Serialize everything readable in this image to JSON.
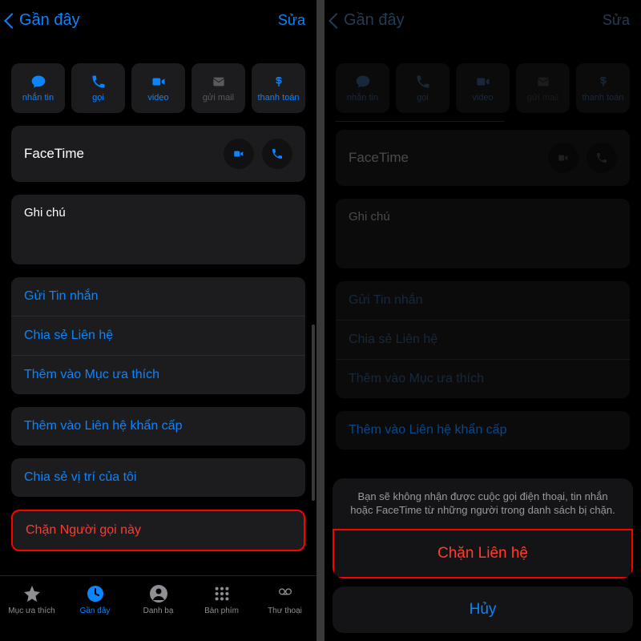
{
  "nav": {
    "back": "Gần đây",
    "edit": "Sửa"
  },
  "quick": {
    "message": "nhắn tin",
    "call": "gọi",
    "video": "video",
    "mail": "gửi mail",
    "pay": "thanh toán"
  },
  "facetime": "FaceTime",
  "notes": "Ghi chú",
  "actions": {
    "send_message": "Gửi Tin nhắn",
    "share_contact": "Chia sẻ Liên hệ",
    "add_favorite": "Thêm vào Mục ưa thích",
    "add_emergency": "Thêm vào Liên hệ khẩn cấp",
    "share_location": "Chia sẻ vị trí của tôi",
    "block": "Chặn Người gọi này"
  },
  "tabs": {
    "favorites": "Mục ưa thích",
    "recents": "Gần đây",
    "contacts": "Danh bạ",
    "keypad": "Bàn phím",
    "voicemail": "Thư thoại"
  },
  "sheet": {
    "text": "Bạn sẽ không nhận được cuộc gọi điện thoại, tin nhắn hoặc FaceTime từ những người trong danh sách bị chặn.",
    "block": "Chặn Liên hệ",
    "cancel": "Hủy"
  }
}
